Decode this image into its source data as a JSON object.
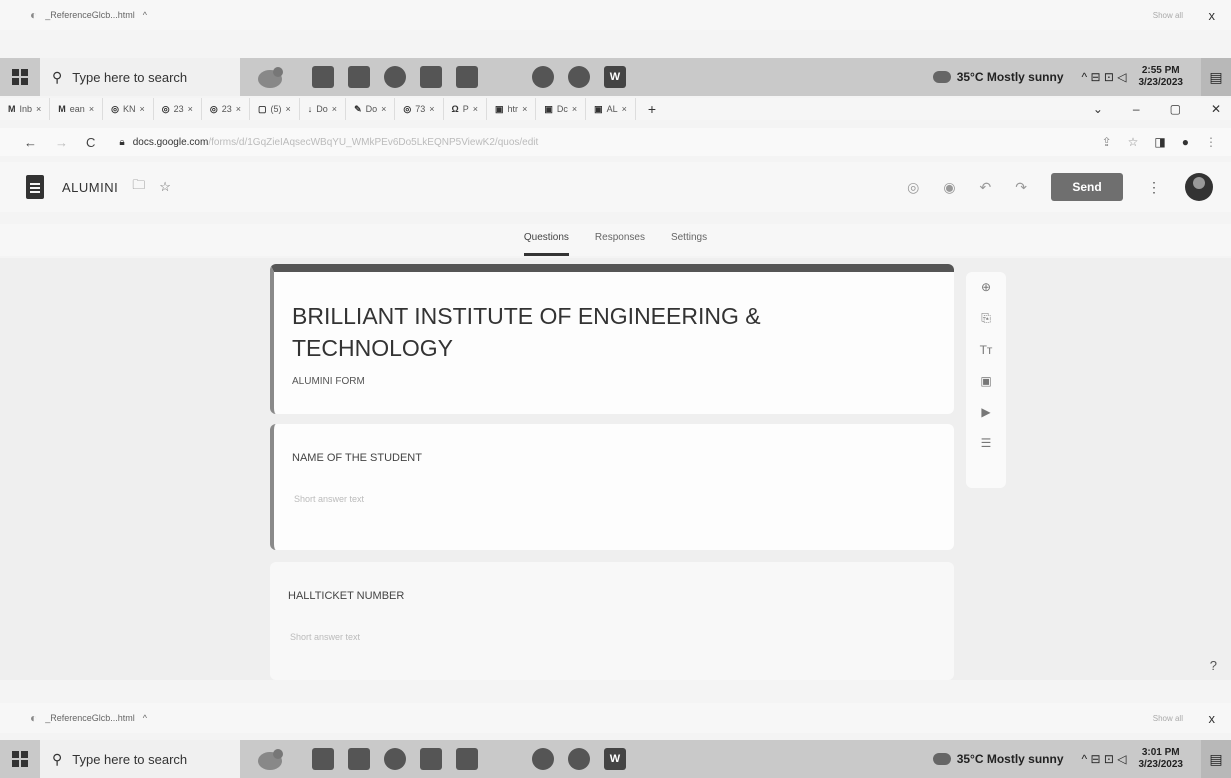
{
  "top_downloads": {
    "file": "_ReferenceGlcb...html",
    "show_all": "Show all",
    "close": "x"
  },
  "top_taskbar": {
    "search_placeholder": "Type here to search",
    "weather": "35°C Mostly sunny",
    "time": "2:55 PM",
    "date": "3/23/2023"
  },
  "tabs": [
    {
      "icon": "M",
      "label": "Inb"
    },
    {
      "icon": "M",
      "label": "ean"
    },
    {
      "icon": "◎",
      "label": "KN"
    },
    {
      "icon": "◎",
      "label": "23"
    },
    {
      "icon": "◎",
      "label": "23"
    },
    {
      "icon": "▢",
      "label": "(5)"
    },
    {
      "icon": "↓",
      "label": "Do"
    },
    {
      "icon": "✎",
      "label": "Do"
    },
    {
      "icon": "◎",
      "label": "73"
    },
    {
      "icon": "Ω",
      "label": "P"
    },
    {
      "icon": "▣",
      "label": "htr"
    },
    {
      "icon": "▣",
      "label": "Dc"
    },
    {
      "icon": "▣",
      "label": "AL"
    }
  ],
  "address": {
    "host": "docs.google.com",
    "path": "/forms/d/1GqZieIAqsecWBqYU_WMkPEv6Do5LkEQNP5ViewK2/quos/edit"
  },
  "form_header": {
    "title": "ALUMINI",
    "send_label": "Send"
  },
  "form_tabs": [
    "Questions",
    "Responses",
    "Settings"
  ],
  "form": {
    "heading": "BRILLIANT INSTITUTE OF ENGINEERING & TECHNOLOGY",
    "description": "ALUMINI FORM",
    "questions": [
      {
        "title": "NAME OF THE STUDENT",
        "placeholder": "Short answer text"
      },
      {
        "title": "HALLTICKET NUMBER",
        "placeholder": "Short answer text"
      }
    ]
  },
  "sidebar_tools": [
    "add-question-icon",
    "import-question-icon",
    "add-title-icon",
    "add-image-icon",
    "add-video-icon",
    "add-section-icon"
  ],
  "bottom_downloads": {
    "file": "_ReferenceGlcb...html",
    "show_all": "Show all",
    "close": "x"
  },
  "bottom_taskbar": {
    "search_placeholder": "Type here to search",
    "weather": "35°C Mostly sunny",
    "time": "3:01 PM",
    "date": "3/23/2023"
  },
  "colors": {
    "accent": "#555555",
    "send_button": "#6f6f6f",
    "background": "#efefef"
  }
}
